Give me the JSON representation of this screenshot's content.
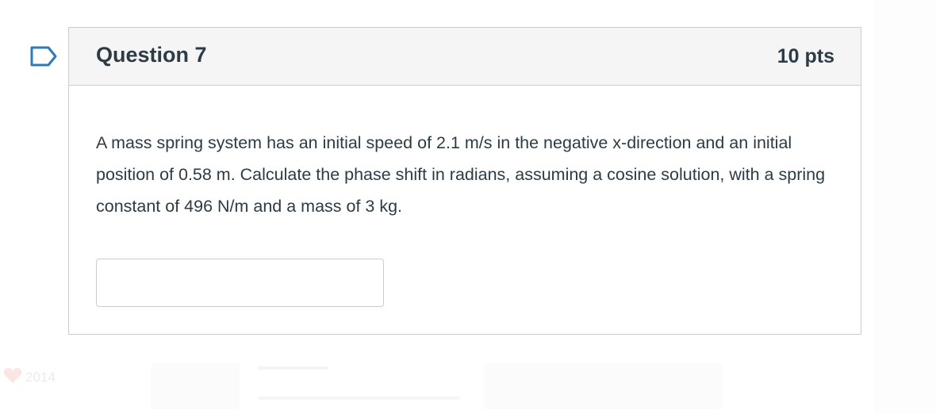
{
  "question": {
    "title": "Question 7",
    "points": "10 pts",
    "text": "A mass spring system has an initial speed of 2.1 m/s in the negative x-direction and an initial position of 0.58 m. Calculate the phase shift in radians, assuming a cosine solution, with a spring constant of 496 N/m and a mass of 3 kg.",
    "answer_value": ""
  },
  "background": {
    "year": "2014"
  },
  "colors": {
    "text": "#2d3b45",
    "header_bg": "#f5f5f5",
    "border": "#c7cdd1",
    "flag": "#2d7ab5"
  },
  "icons": {
    "flag": "flag-icon",
    "heart": "heart-icon"
  }
}
